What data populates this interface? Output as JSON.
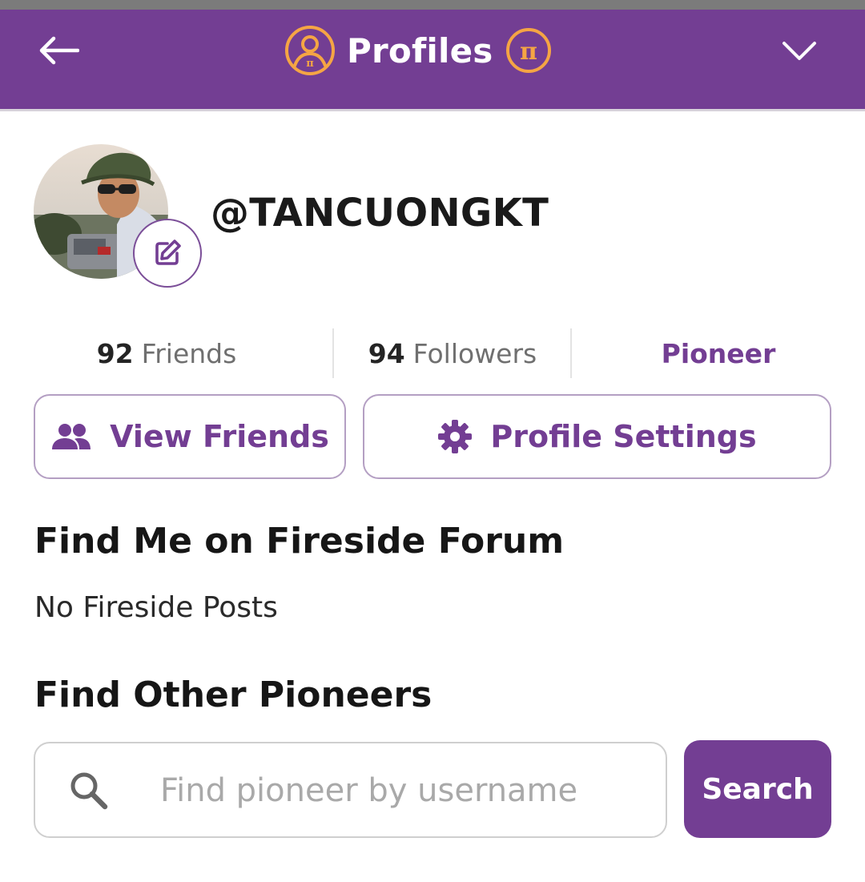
{
  "header": {
    "title": "Profiles",
    "back_icon": "arrow-left-icon",
    "left_icon": "pi-profile-icon",
    "right_icon": "pi-coin-icon",
    "menu_icon": "chevron-down-icon",
    "bar_color": "#733e93",
    "icon_accent": "#f5a544"
  },
  "profile": {
    "username": "@TANCUONGKT",
    "avatar_icon": "avatar",
    "edit_icon": "edit-icon"
  },
  "stats": {
    "friends_count": "92",
    "friends_label": "Friends",
    "followers_count": "94",
    "followers_label": "Followers",
    "role": "Pioneer"
  },
  "actions": {
    "view_friends_label": "View Friends",
    "view_friends_icon": "people-icon",
    "settings_label": "Profile Settings",
    "settings_icon": "gear-icon"
  },
  "fireside": {
    "heading": "Find Me on Fireside Forum",
    "empty_text": "No Fireside Posts"
  },
  "find": {
    "heading": "Find Other Pioneers",
    "search_placeholder": "Find pioneer by username",
    "search_icon": "search-icon",
    "search_button": "Search"
  }
}
